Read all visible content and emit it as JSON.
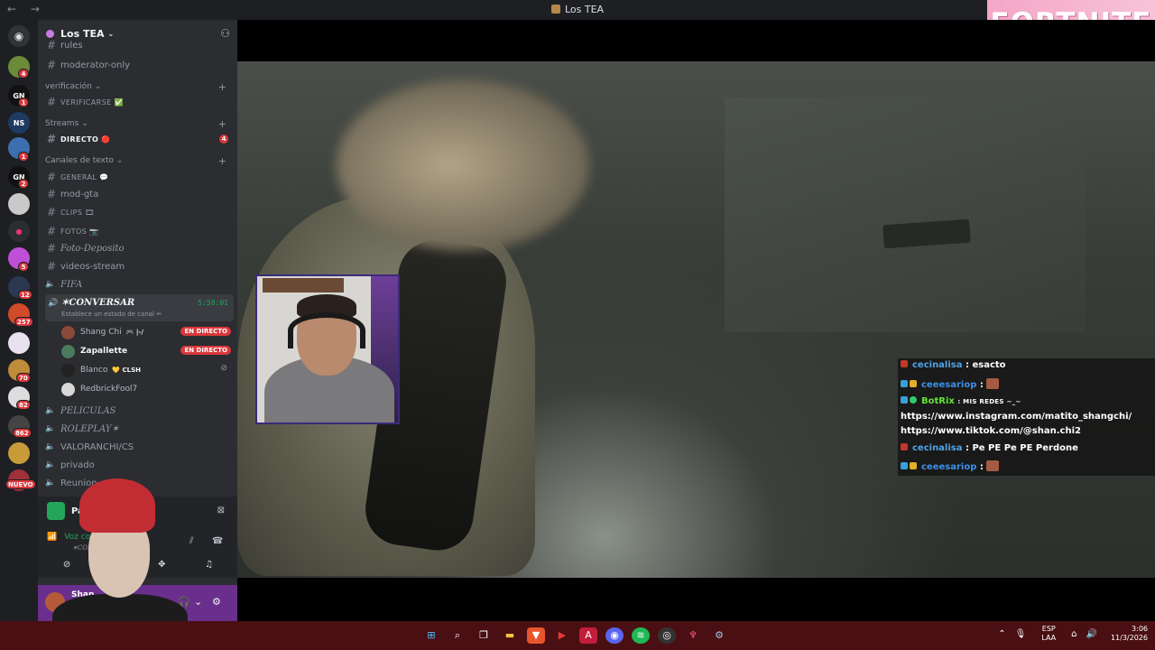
{
  "window": {
    "title": "Los TEA",
    "nav": "← →"
  },
  "overlay_logo": "FORTNITE",
  "rail": {
    "badges": [
      "4",
      "1",
      "1",
      "2",
      "5",
      "12",
      "257",
      "70",
      "82",
      "862",
      "NUEVO"
    ]
  },
  "server": {
    "name": "Los TEA"
  },
  "channels": {
    "rules_partial": "rules",
    "moderator_only": "moderator-only",
    "cat_verificacion": "verificación",
    "verificarse": "VERIFICARSE ✅",
    "cat_streams": "Streams",
    "directo": "DIRECTO 🔴",
    "directo_badge": "4",
    "cat_texto": "Canales de texto",
    "general": "GENERAL 💬",
    "mod_gta": "mod-gta",
    "clips": "CLIPS 🎞",
    "fotos": "FOTOS 📷",
    "foto_deposito": "Foto-Deposito",
    "videos_stream": "videos-stream",
    "fifa": "FIFA",
    "conversar": "✶CONVERSAR",
    "conversar_time": "5:58:01",
    "conversar_status": "Establece un estado de canal ✏",
    "peliculas": "PELICULAS",
    "roleplay": "ROLEPLAY✶",
    "valoranchi": "VALORANCHI/CS",
    "privado": "privado",
    "reunion": "Reunion"
  },
  "voice_users": [
    {
      "name": "Shang Chi",
      "extra": "🎮 |-/",
      "live": "EN DIRECTO"
    },
    {
      "name": "Zapallette",
      "extra": "",
      "live": "EN DIRECTO"
    },
    {
      "name": "Blanco",
      "extra": "💛 CLSH",
      "live": ""
    },
    {
      "name": "RedbrickFool7",
      "extra": "",
      "live": ""
    }
  ],
  "stream_panel": {
    "screen": "Pantalla 1",
    "voice_connected": "Voz conect",
    "voice_channel": "✶CONVERSA"
  },
  "user": {
    "name": "Shan"
  },
  "chat": [
    {
      "user": "cecinalisa",
      "text": ": esacto"
    },
    {
      "user": "ceeesariop",
      "text": ":"
    },
    {
      "user": "BotRix",
      "text": ": MIS REDES ~_~"
    },
    {
      "user": "",
      "text": "https://www.instagram.com/matito_shangchi/"
    },
    {
      "user": "",
      "text": "https://www.tiktok.com/@shan.chi2"
    },
    {
      "user": "cecinalisa",
      "text": ": Pe PE Pe PE Perdone"
    },
    {
      "user": "ceeesariop",
      "text": ":"
    }
  ],
  "taskbar": {
    "lang_top": "ESP",
    "lang_bottom": "LAA",
    "time": "3:06",
    "date": "11/3/2026"
  },
  "colors": {
    "accent_green": "#23a55a",
    "live_red": "#da373c",
    "taskbar": "#4a0f13"
  }
}
